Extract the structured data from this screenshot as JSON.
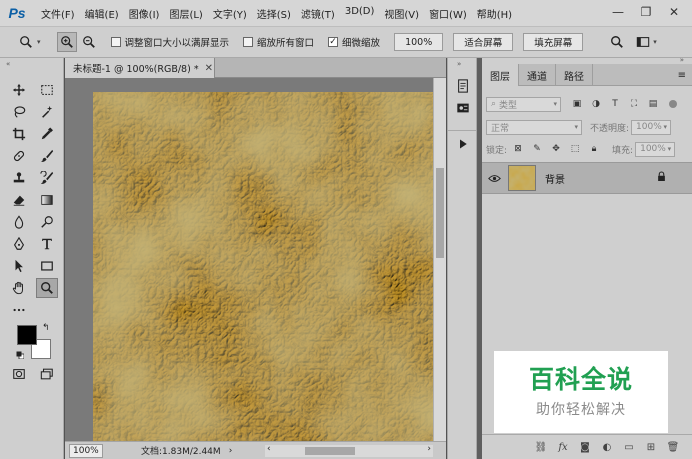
{
  "app": {
    "logo": "Ps",
    "menus": [
      "文件(F)",
      "编辑(E)",
      "图像(I)",
      "图层(L)",
      "文字(Y)",
      "选择(S)",
      "滤镜(T)",
      "3D(D)",
      "视图(V)",
      "窗口(W)",
      "帮助(H)"
    ],
    "window_controls": {
      "minimize": "—",
      "restore": "❐",
      "close": "✕"
    }
  },
  "options_bar": {
    "tool": "zoom-tool",
    "resize_windows_label": "调整窗口大小以满屏显示",
    "resize_windows_checked": false,
    "zoom_all_label": "缩放所有窗口",
    "zoom_all_checked": false,
    "scrubby_zoom_label": "细微缩放",
    "scrubby_zoom_checked": true,
    "btn_100": "100%",
    "btn_fit": "适合屏幕",
    "btn_fill": "填充屏幕"
  },
  "document": {
    "tab_title": "未标题-1 @ 100%(RGB/8) *",
    "zoom": "100%",
    "doc_info": "文档:1.83M/2.44M",
    "texture_colors": {
      "base": "#c9a84a",
      "light": "#e8d38a",
      "dark": "#8f7430"
    }
  },
  "layers_panel": {
    "tabs": [
      "图层",
      "通道",
      "路径"
    ],
    "active_tab": "图层",
    "filter_kind": "类型",
    "blend_mode": "正常",
    "opacity_label": "不透明度:",
    "opacity_value": "100%",
    "lock_label": "锁定:",
    "fill_label": "填充:",
    "fill_value": "100%",
    "layers": [
      {
        "name": "背景",
        "visible": true,
        "locked": true
      }
    ]
  },
  "watermark": {
    "title": "百科全说",
    "subtitle": "助你轻松解决"
  },
  "colors": {
    "foreground": "#000000",
    "background": "#ffffff",
    "watermark_green": "#21a052"
  }
}
